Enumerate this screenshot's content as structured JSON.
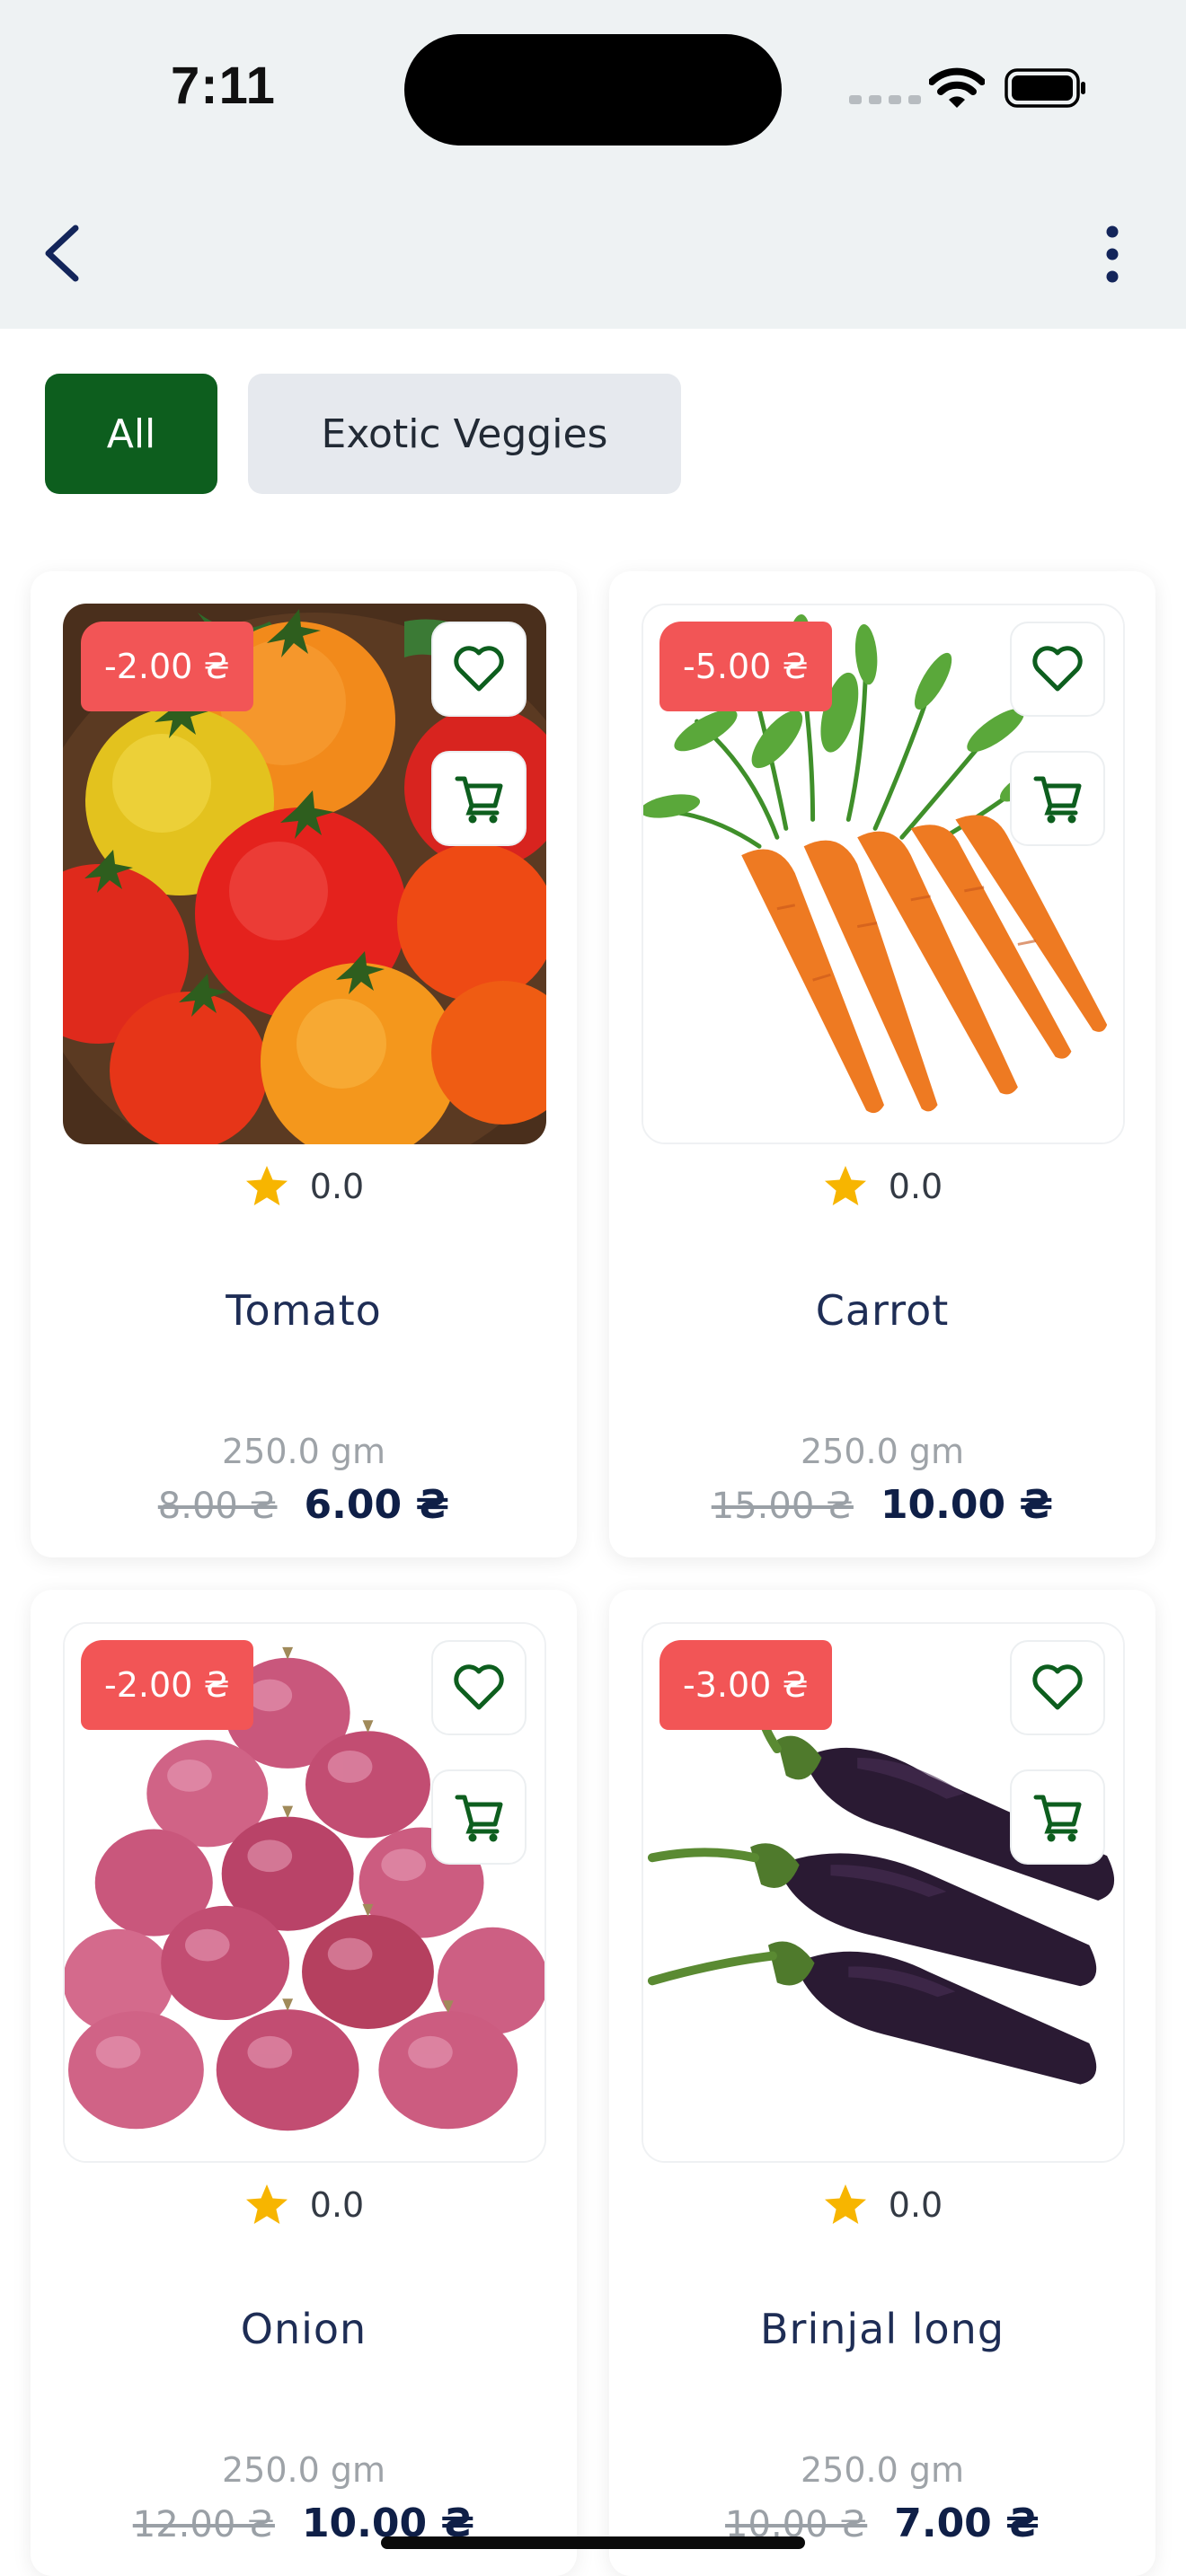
{
  "status_bar": {
    "time": "7:11"
  },
  "categories": [
    {
      "label": "All",
      "selected": true
    },
    {
      "label": "Exotic Veggies",
      "selected": false
    }
  ],
  "products": [
    {
      "name": "Tomato",
      "discount": "-2.00 ₴",
      "rating": "0.0",
      "weight": "250.0 gm",
      "old_price": "8.00 ₴",
      "price": "6.00 ₴"
    },
    {
      "name": "Carrot",
      "discount": "-5.00 ₴",
      "rating": "0.0",
      "weight": "250.0 gm",
      "old_price": "15.00 ₴",
      "price": "10.00 ₴"
    },
    {
      "name": "Onion",
      "discount": "-2.00 ₴",
      "rating": "0.0",
      "weight": "250.0 gm",
      "old_price": "12.00 ₴",
      "price": "10.00 ₴"
    },
    {
      "name": "Brinjal long",
      "discount": "-3.00 ₴",
      "rating": "0.0",
      "weight": "250.0 gm",
      "old_price": "10.00 ₴",
      "price": "7.00 ₴"
    }
  ],
  "colors": {
    "brand_green": "#0d5e1e",
    "discount_red": "#f25556",
    "star_yellow": "#f7b500",
    "price_navy": "#0f1f47"
  },
  "icons": [
    "back-arrow-icon",
    "more-vertical-icon",
    "heart-icon",
    "cart-icon",
    "star-icon",
    "wifi-icon",
    "battery-icon"
  ]
}
